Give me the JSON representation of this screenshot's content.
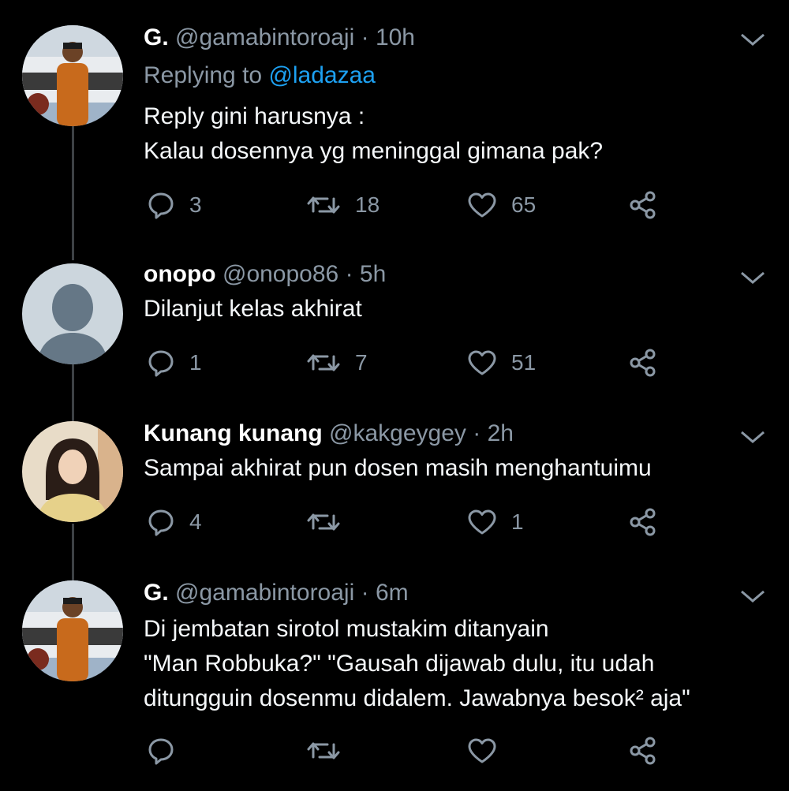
{
  "tweets": [
    {
      "name": "G.",
      "handle": "@gamabintoroaji",
      "time": "10h",
      "replying_prefix": "Replying to ",
      "replying_to": "@ladazaa",
      "lines": [
        "Reply gini harusnya :",
        "Kalau dosennya yg meninggal gimana pak?"
      ],
      "replies": "3",
      "retweets": "18",
      "likes": "65"
    },
    {
      "name": "onopo",
      "handle": "@onopo86",
      "time": "5h",
      "lines": [
        "Dilanjut kelas akhirat"
      ],
      "replies": "1",
      "retweets": "7",
      "likes": "51"
    },
    {
      "name": "Kunang kunang",
      "handle": "@kakgeygey",
      "time": "2h",
      "lines": [
        "Sampai akhirat pun dosen masih menghantuimu"
      ],
      "replies": "4",
      "retweets": "",
      "likes": "1"
    },
    {
      "name": "G.",
      "handle": "@gamabintoroaji",
      "time": "6m",
      "lines": [
        "Di jembatan sirotol mustakim ditanyain",
        "\"Man Robbuka?\" \"Gausah dijawab dulu, itu udah",
        "ditungguin dosenmu didalem. Jawabnya besok² aja\""
      ],
      "replies": "",
      "retweets": "",
      "likes": ""
    }
  ],
  "separator": " · ",
  "icons": {
    "reply": "reply-icon",
    "retweet": "retweet-icon",
    "like": "heart-icon",
    "share": "share-icon",
    "caret": "chevron-down-icon"
  },
  "colors": {
    "background": "#000000",
    "text": "#f5f8fa",
    "muted": "#8b98a5",
    "link": "#1da1f2",
    "thread_line": "#3d4145"
  }
}
